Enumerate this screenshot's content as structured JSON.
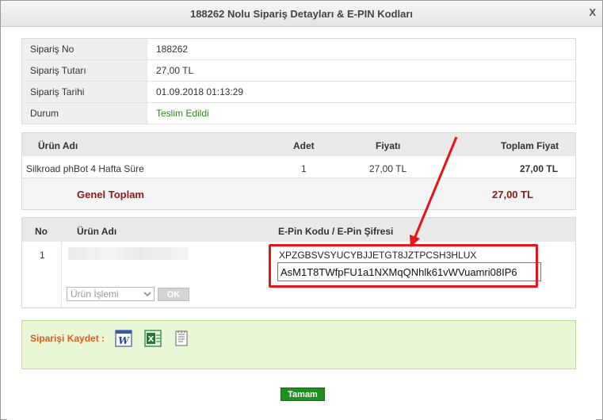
{
  "dialog": {
    "title": "188262 Nolu Sipariş Detayları & E-PIN Kodları",
    "close": "X"
  },
  "order_info": [
    {
      "key": "Sipariş No",
      "value": "188262"
    },
    {
      "key": "Sipariş Tutarı",
      "value": "27,00 TL"
    },
    {
      "key": "Sipariş Tarihi",
      "value": "01.09.2018 01:13:29"
    },
    {
      "key": "Durum",
      "value": "Teslim Edildi"
    }
  ],
  "products": {
    "headers": {
      "name": "Ürün Adı",
      "qty": "Adet",
      "price": "Fiyatı",
      "total": "Toplam Fiyat"
    },
    "row": {
      "name": "Silkroad phBot 4 Hafta Süre",
      "qty": "1",
      "price": "27,00 TL",
      "total": "27,00 TL"
    },
    "grand_total_label": "Genel Toplam",
    "grand_total_value": "27,00 TL"
  },
  "epin": {
    "headers": {
      "no": "No",
      "name": "Ürün Adı",
      "code": "E-Pin Kodu / E-Pin Şifresi"
    },
    "row": {
      "no": "1",
      "code": "XPZGBSVSYUCYBJJETGT8JZTPCSH3HLUX",
      "password": "AsM1T8TWfpFU1a1NXMqQNhlk61vWVuamri08IP6"
    },
    "operation_select": "Ürün İşlemi",
    "ok_label": "OK"
  },
  "save_panel": {
    "label": "Siparişi Kaydet :",
    "icons": [
      "word-icon",
      "excel-icon",
      "text-file-icon"
    ]
  },
  "footer": {
    "confirm_label": "Tamam"
  },
  "colors": {
    "status_green": "#2d8a1c",
    "total_red": "#8b1a1a",
    "highlight_red": "#e8141a",
    "save_bg": "#e9f7d7",
    "save_label": "#e05a1c",
    "confirm_btn": "#1f8f1f"
  }
}
